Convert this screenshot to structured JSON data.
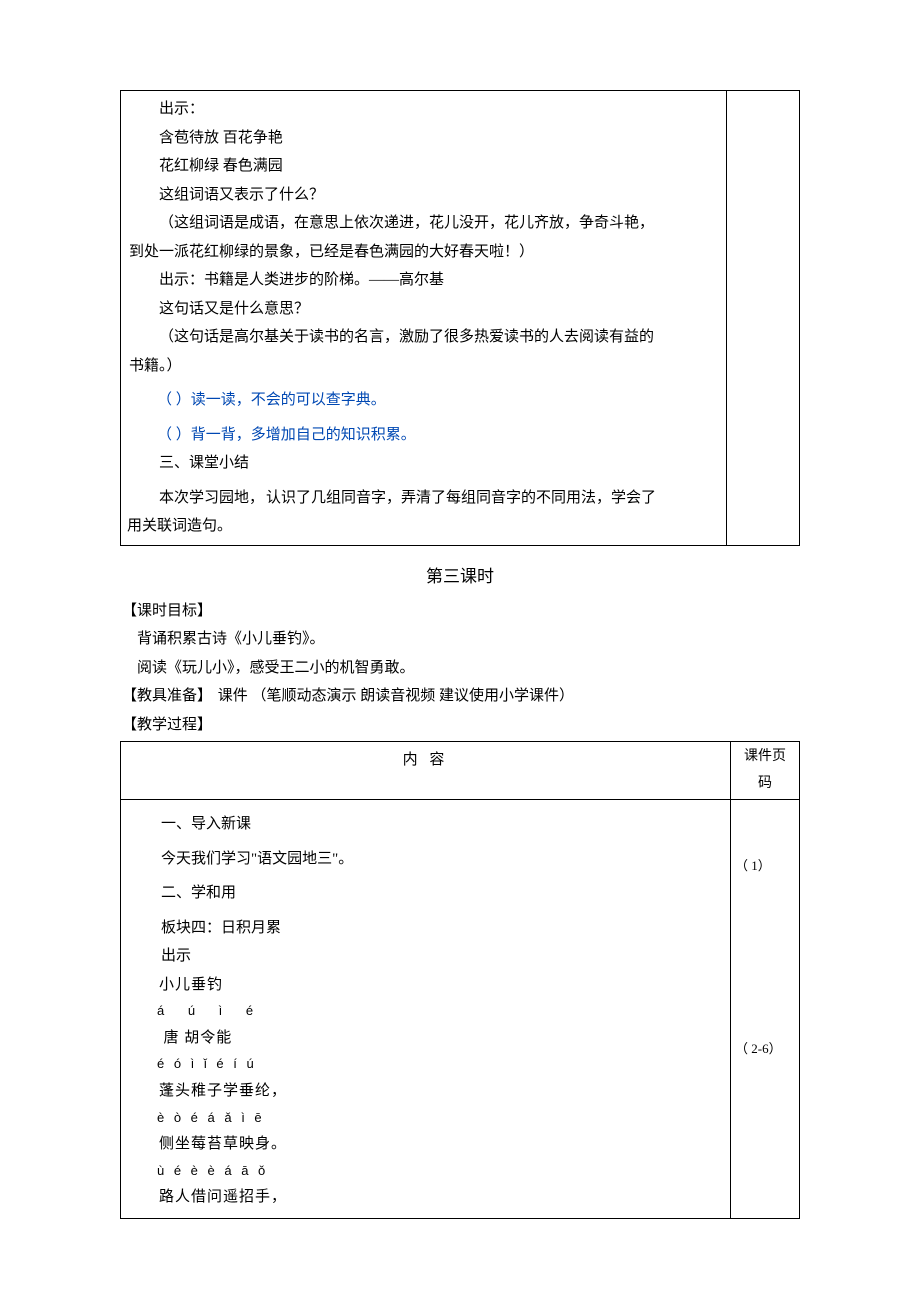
{
  "part1": {
    "l1": "出示：",
    "l2": "含苞待放 百花争艳",
    "l3": "花红柳绿 春色满园",
    "l4": "这组词语又表示了什么？",
    "l5": "（这组词语是成语，在意思上依次递进，花儿没开，花儿齐放，争奇斗艳，",
    "l5b": "到处一派花红柳绿的景象，已经是春色满园的大好春天啦！）",
    "l6": "出示：书籍是人类进步的阶梯。——高尔基",
    "l7": "这句话又是什么意思？",
    "l8": "（这句话是高尔基关于读书的名言，激励了很多热爱读书的人去阅读有益的",
    "l8b": "书籍。）",
    "b1": "（ ）读一读，不会的可以查字典。",
    "b2": "（ ）背一背，多增加自己的知识积累。",
    "l9": "三、课堂小结",
    "l10a": "本次学习园地，",
    "l10b": "认识了几组同音字，弄清了每组同音字的不同用法，学会了",
    "l10c": "用关联词造句。"
  },
  "sec3": {
    "title": "第三课时",
    "goal_h": "【课时目标】",
    "goal1": "背诵积累古诗《小儿垂钓》。",
    "goal2": "阅读《玩儿小》，感受王二小的机智勇敢。",
    "prep_h": "【教具准备】",
    "prep_t": " 课件  （笔顺动态演示   朗读音视频   建议使用小学课件）",
    "proc_h": "【教学过程】",
    "col1": "内   容",
    "col2a": "课件页",
    "col2b": "码",
    "intro_h": "一、导入新课",
    "intro_t": "今天我们学习\"语文园地三\"。",
    "s2_h": "二、学和用",
    "s2_sub": "板块四：日积月累",
    "show": "出示",
    "poem_title": "小儿垂钓",
    "poem_title_py": "á   ú  ì    é",
    "author": "唐 胡令能",
    "py1": "é   ó   ì  ǐ   é    í  ú",
    "ln1": "蓬头稚子学垂纶，",
    "py2": "è   ò  é   á   ǎ   ì    ē",
    "ln2": "侧坐莓苔草映身。",
    "py3": "ù  é   è  è   á    ā    ǒ",
    "ln3": "路人借问遥招手，",
    "ref1": "（ 1）",
    "ref2": "（ 2-6）"
  }
}
